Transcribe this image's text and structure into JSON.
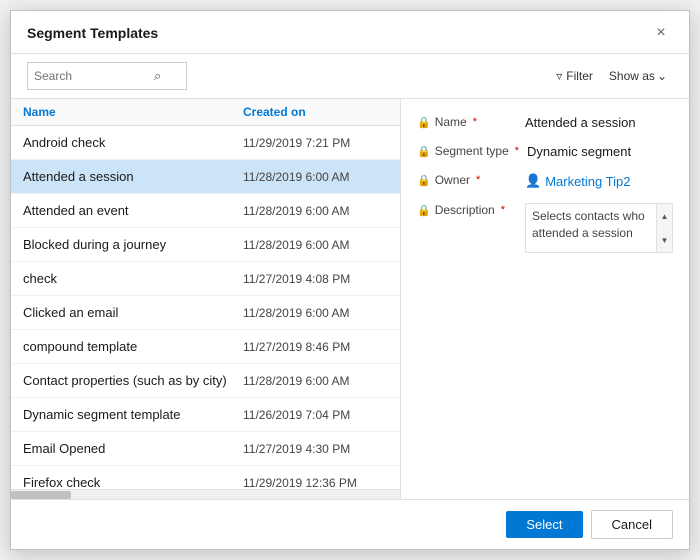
{
  "dialog": {
    "title": "Segment Templates",
    "close_label": "×"
  },
  "toolbar": {
    "search_placeholder": "Search",
    "filter_label": "Filter",
    "show_as_label": "Show as"
  },
  "list": {
    "col_name": "Name",
    "col_date": "Created on",
    "items": [
      {
        "name": "Android check",
        "date": "11/29/2019 7:21 PM",
        "selected": false
      },
      {
        "name": "Attended a session",
        "date": "11/28/2019 6:00 AM",
        "selected": true
      },
      {
        "name": "Attended an event",
        "date": "11/28/2019 6:00 AM",
        "selected": false
      },
      {
        "name": "Blocked during a journey",
        "date": "11/28/2019 6:00 AM",
        "selected": false
      },
      {
        "name": "check",
        "date": "11/27/2019 4:08 PM",
        "selected": false
      },
      {
        "name": "Clicked an email",
        "date": "11/28/2019 6:00 AM",
        "selected": false
      },
      {
        "name": "compound template",
        "date": "11/27/2019 8:46 PM",
        "selected": false
      },
      {
        "name": "Contact properties (such as by city)",
        "date": "11/28/2019 6:00 AM",
        "selected": false
      },
      {
        "name": "Dynamic segment template",
        "date": "11/26/2019 7:04 PM",
        "selected": false
      },
      {
        "name": "Email Opened",
        "date": "11/27/2019 4:30 PM",
        "selected": false
      },
      {
        "name": "Firefox check",
        "date": "11/29/2019 12:36 PM",
        "selected": false
      }
    ]
  },
  "detail": {
    "name_label": "Name",
    "name_value": "Attended a session",
    "segment_type_label": "Segment type",
    "segment_type_value": "Dynamic segment",
    "owner_label": "Owner",
    "owner_value": "Marketing Tip2",
    "description_label": "Description",
    "description_text": "Selects contacts who\nattended a session"
  },
  "footer": {
    "select_label": "Select",
    "cancel_label": "Cancel"
  },
  "icons": {
    "search": "🔍",
    "close": "✕",
    "filter": "▽",
    "chevron_down": "∨",
    "lock": "🔒",
    "person": "👤"
  }
}
